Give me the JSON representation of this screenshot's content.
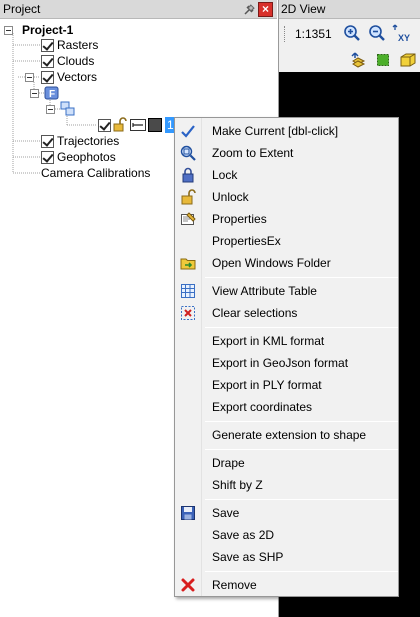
{
  "project_panel": {
    "title": "Project",
    "pin_icon": "pin-icon",
    "close_icon": "close-icon",
    "tree": {
      "root": "Project-1",
      "rasters": "Rasters",
      "clouds": "Clouds",
      "vectors": "Vectors",
      "selected_layer_name": "1",
      "trajectories": "Trajectories",
      "geophotos": "Geophotos",
      "camera_calibrations": "Camera Calibrations"
    }
  },
  "view_panel": {
    "title": "2D View",
    "scale": "1:1351",
    "toolbar_icons": [
      "zoom-in-icon",
      "zoom-out-icon",
      "xy-icon",
      "layer-up-icon",
      "green-square-icon",
      "yellow-box-icon"
    ],
    "canvas_color": "#000000"
  },
  "context_menu": {
    "items": [
      {
        "label": "Make Current [dbl-click]",
        "icon": "checkmark-icon"
      },
      {
        "label": "Zoom to Extent",
        "icon": "zoom-extent-icon"
      },
      {
        "label": "Lock",
        "icon": "lock-icon"
      },
      {
        "label": "Unlock",
        "icon": "unlock-icon"
      },
      {
        "label": "Properties",
        "icon": "properties-icon"
      },
      {
        "label": "PropertiesEx",
        "icon": ""
      },
      {
        "label": "Open Windows Folder",
        "icon": "folder-icon"
      },
      {
        "label": "View Attribute Table",
        "icon": "table-icon"
      },
      {
        "label": "Clear selections",
        "icon": "clear-selection-icon"
      },
      {
        "label": "Export in KML format",
        "icon": ""
      },
      {
        "label": "Export in GeoJson format",
        "icon": ""
      },
      {
        "label": "Export in PLY format",
        "icon": ""
      },
      {
        "label": "Export coordinates",
        "icon": ""
      },
      {
        "label": "Generate extension to shape",
        "icon": ""
      },
      {
        "label": "Drape",
        "icon": ""
      },
      {
        "label": "Shift by Z",
        "icon": ""
      },
      {
        "label": "Save",
        "icon": "save-icon"
      },
      {
        "label": "Save as 2D",
        "icon": ""
      },
      {
        "label": "Save as SHP",
        "icon": ""
      },
      {
        "label": "Remove",
        "icon": "remove-icon"
      }
    ]
  },
  "colors": {
    "panel_header": "#d9d9d9",
    "menu_background": "#f1f1f1",
    "selection": "#3399ff",
    "close_button": "#d8302b"
  }
}
